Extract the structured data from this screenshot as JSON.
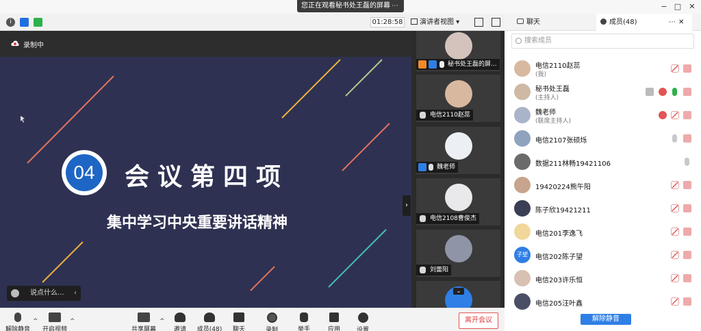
{
  "banner": {
    "text": "您正在观看秘书处王磊的屏幕",
    "more": "⋯"
  },
  "window": {
    "minimize": "−",
    "maximize": "□",
    "close": "✕"
  },
  "toolbar": {
    "timer": "01:28:58",
    "view_label": "演讲者视图 ▾"
  },
  "right_tabs": {
    "chat": "聊天",
    "members": "成员(48)",
    "more": "⋯",
    "close": "✕"
  },
  "recording": {
    "label": "录制中"
  },
  "slide": {
    "number": "04",
    "title": "会议第四项",
    "subtitle": "集中学习中央重要讲话精神"
  },
  "danmu": {
    "placeholder": "说点什么..."
  },
  "video_tiles": [
    {
      "label": "秘书处王磊的屏..."
    },
    {
      "label": "电信2110赵蕊"
    },
    {
      "label": "魏老师"
    },
    {
      "label": "电信2108曹俊杰"
    },
    {
      "label": "刘蕾阳"
    },
    {
      "label": ""
    }
  ],
  "bottom": {
    "unmute": "解除静音",
    "video": "开启视频",
    "share": "共享屏幕",
    "invite": "邀请",
    "members": "成员(48)",
    "chat": "聊天",
    "record": "录制",
    "raise_hand": "举手",
    "apps": "应用",
    "settings": "设置",
    "leave": "离开会议"
  },
  "member_search": {
    "placeholder": "搜索成员"
  },
  "members": [
    {
      "name": "电信2110赵蕊",
      "role": "(我)",
      "avatar_text": ""
    },
    {
      "name": "秘书处王磊",
      "role": "(主持人)",
      "avatar_text": ""
    },
    {
      "name": "魏老师",
      "role": "(联席主持人)",
      "avatar_text": ""
    },
    {
      "name": "电信2107张硕烁",
      "role": "",
      "avatar_text": ""
    },
    {
      "name": "数据211林畅19421106",
      "role": "",
      "avatar_text": ""
    },
    {
      "name": "19420224熊午阳",
      "role": "",
      "avatar_text": ""
    },
    {
      "name": "陈子欣19421211",
      "role": "",
      "avatar_text": ""
    },
    {
      "name": "电信201李逸飞",
      "role": "",
      "avatar_text": ""
    },
    {
      "name": "电信202陈子望",
      "role": "",
      "avatar_text": "子望"
    },
    {
      "name": "电信203许乐恒",
      "role": "",
      "avatar_text": ""
    },
    {
      "name": "电信205汪叶鑫",
      "role": "",
      "avatar_text": ""
    }
  ],
  "unmute_all": "解除静音",
  "colors": {
    "accent": "#2f7fe6",
    "leave": "#e03c3c",
    "slide_bg": "#2f3152",
    "mic_on": "#2bb24c"
  }
}
